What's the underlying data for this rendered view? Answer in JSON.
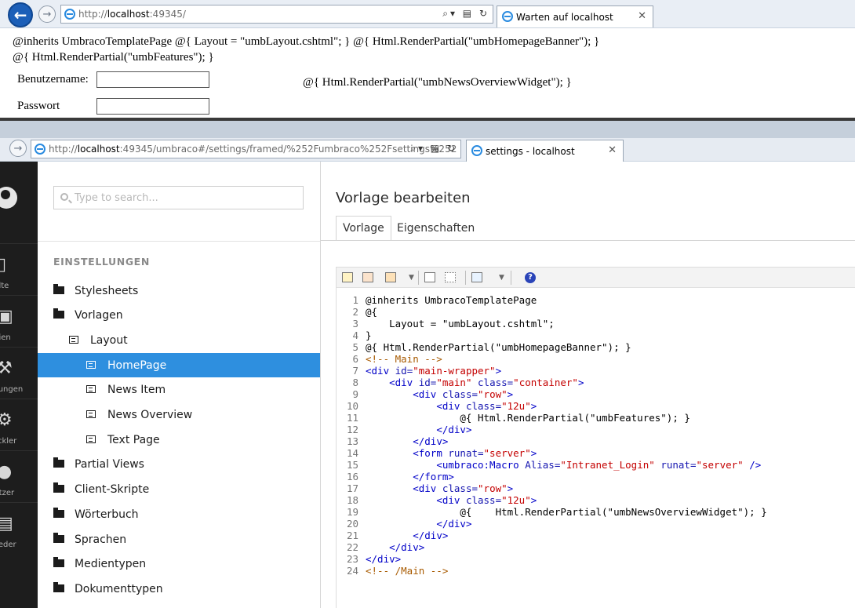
{
  "window1": {
    "url_host": "localhost",
    "url_rest": ":49345/",
    "url_prefix": "http://",
    "tab_title": "Warten auf localhost",
    "tab_close": "✕",
    "raw_line1": "@inherits UmbracoTemplatePage @{ Layout = \"umbLayout.cshtml\"; } @{ Html.RenderPartial(\"umbHomepageBanner\"); }",
    "raw_line2": "@{ Html.RenderPartial(\"umbFeatures\"); }",
    "raw_widget": "@{ Html.RenderPartial(\"umbNewsOverviewWidget\"); }",
    "username_label": "Benutzername:",
    "password_label": "Passwort",
    "username_value": "",
    "password_value": ""
  },
  "window2": {
    "url_prefix": "http://",
    "url_host": "localhost",
    "url_rest": ":49345/umbraco#/settings/framed/%252Fumbraco%252Fsettings%252",
    "tab_title": "settings - localhost",
    "tab_close": "✕"
  },
  "sections": [
    {
      "label": "halte",
      "icon": "document-icon"
    },
    {
      "label": "edien",
      "icon": "image-icon"
    },
    {
      "label": "ellungen",
      "icon": "wrench-icon"
    },
    {
      "label": "wickler",
      "icon": "gear-icon"
    },
    {
      "label": "nutzer",
      "icon": "user-icon"
    },
    {
      "label": "glieder",
      "icon": "id-card-icon"
    }
  ],
  "tree": {
    "search_placeholder": "Type to search...",
    "section_title": "EINSTELLUNGEN",
    "items": [
      {
        "label": "Stylesheets",
        "type": "folder"
      },
      {
        "label": "Vorlagen",
        "type": "folder"
      },
      {
        "label": "Layout",
        "type": "doc"
      },
      {
        "label": "HomePage",
        "type": "doc",
        "active": true
      },
      {
        "label": "News Item",
        "type": "doc"
      },
      {
        "label": "News Overview",
        "type": "doc"
      },
      {
        "label": "Text Page",
        "type": "doc"
      },
      {
        "label": "Partial Views",
        "type": "folder"
      },
      {
        "label": "Client-Skripte",
        "type": "folder"
      },
      {
        "label": "Wörterbuch",
        "type": "folder"
      },
      {
        "label": "Sprachen",
        "type": "folder"
      },
      {
        "label": "Medientypen",
        "type": "folder"
      },
      {
        "label": "Dokumenttypen",
        "type": "folder"
      }
    ]
  },
  "editor": {
    "title": "Vorlage bearbeiten",
    "tabs": [
      "Vorlage",
      "Eigenschaften"
    ],
    "help_label": "?",
    "code_lines": [
      [
        [
          "razor",
          "@inherits UmbracoTemplatePage"
        ]
      ],
      [
        [
          "razor",
          "@{"
        ]
      ],
      [
        [
          "razor",
          "    Layout = \"umbLayout.cshtml\";"
        ]
      ],
      [
        [
          "razor",
          "}"
        ]
      ],
      [
        [
          "razor",
          "@{ Html.RenderPartial(\"umbHomepageBanner\"); }"
        ]
      ],
      [
        [
          "comment",
          "<!-- Main -->"
        ]
      ],
      [
        [
          "tag",
          "<div "
        ],
        [
          "attr",
          "id="
        ],
        [
          "val",
          "\"main-wrapper\""
        ],
        [
          "tag",
          ">"
        ]
      ],
      [
        [
          "plain",
          "    "
        ],
        [
          "tag",
          "<div "
        ],
        [
          "attr",
          "id="
        ],
        [
          "val",
          "\"main\""
        ],
        [
          "plain",
          " "
        ],
        [
          "attr",
          "class="
        ],
        [
          "val",
          "\"container\""
        ],
        [
          "tag",
          ">"
        ]
      ],
      [
        [
          "plain",
          "        "
        ],
        [
          "tag",
          "<div "
        ],
        [
          "attr",
          "class="
        ],
        [
          "val",
          "\"row\""
        ],
        [
          "tag",
          ">"
        ]
      ],
      [
        [
          "plain",
          "            "
        ],
        [
          "tag",
          "<div "
        ],
        [
          "attr",
          "class="
        ],
        [
          "val",
          "\"12u\""
        ],
        [
          "tag",
          ">"
        ]
      ],
      [
        [
          "plain",
          "                @{ Html.RenderPartial(\"umbFeatures\"); }"
        ]
      ],
      [
        [
          "plain",
          "            "
        ],
        [
          "tag",
          "</div>"
        ]
      ],
      [
        [
          "plain",
          "        "
        ],
        [
          "tag",
          "</div>"
        ]
      ],
      [
        [
          "plain",
          "        "
        ],
        [
          "tag",
          "<form "
        ],
        [
          "attr",
          "runat="
        ],
        [
          "val",
          "\"server\""
        ],
        [
          "tag",
          ">"
        ]
      ],
      [
        [
          "plain",
          "            "
        ],
        [
          "tag",
          "<umbraco:Macro "
        ],
        [
          "attr",
          "Alias="
        ],
        [
          "val",
          "\"Intranet_Login\""
        ],
        [
          "plain",
          " "
        ],
        [
          "attr",
          "runat="
        ],
        [
          "val",
          "\"server\""
        ],
        [
          "plain",
          " "
        ],
        [
          "tag",
          "/>"
        ]
      ],
      [
        [
          "plain",
          "        "
        ],
        [
          "tag",
          "</form>"
        ]
      ],
      [
        [
          "plain",
          "        "
        ],
        [
          "tag",
          "<div "
        ],
        [
          "attr",
          "class="
        ],
        [
          "val",
          "\"row\""
        ],
        [
          "tag",
          ">"
        ]
      ],
      [
        [
          "plain",
          "            "
        ],
        [
          "tag",
          "<div "
        ],
        [
          "attr",
          "class="
        ],
        [
          "val",
          "\"12u\""
        ],
        [
          "tag",
          ">"
        ]
      ],
      [
        [
          "plain",
          "                @{    Html.RenderPartial(\"umbNewsOverviewWidget\"); }"
        ]
      ],
      [
        [
          "plain",
          "            "
        ],
        [
          "tag",
          "</div>"
        ]
      ],
      [
        [
          "plain",
          "        "
        ],
        [
          "tag",
          "</div>"
        ]
      ],
      [
        [
          "plain",
          "    "
        ],
        [
          "tag",
          "</div>"
        ]
      ],
      [
        [
          "tag",
          "</div>"
        ]
      ],
      [
        [
          "comment",
          "<!-- /Main -->"
        ]
      ]
    ]
  }
}
